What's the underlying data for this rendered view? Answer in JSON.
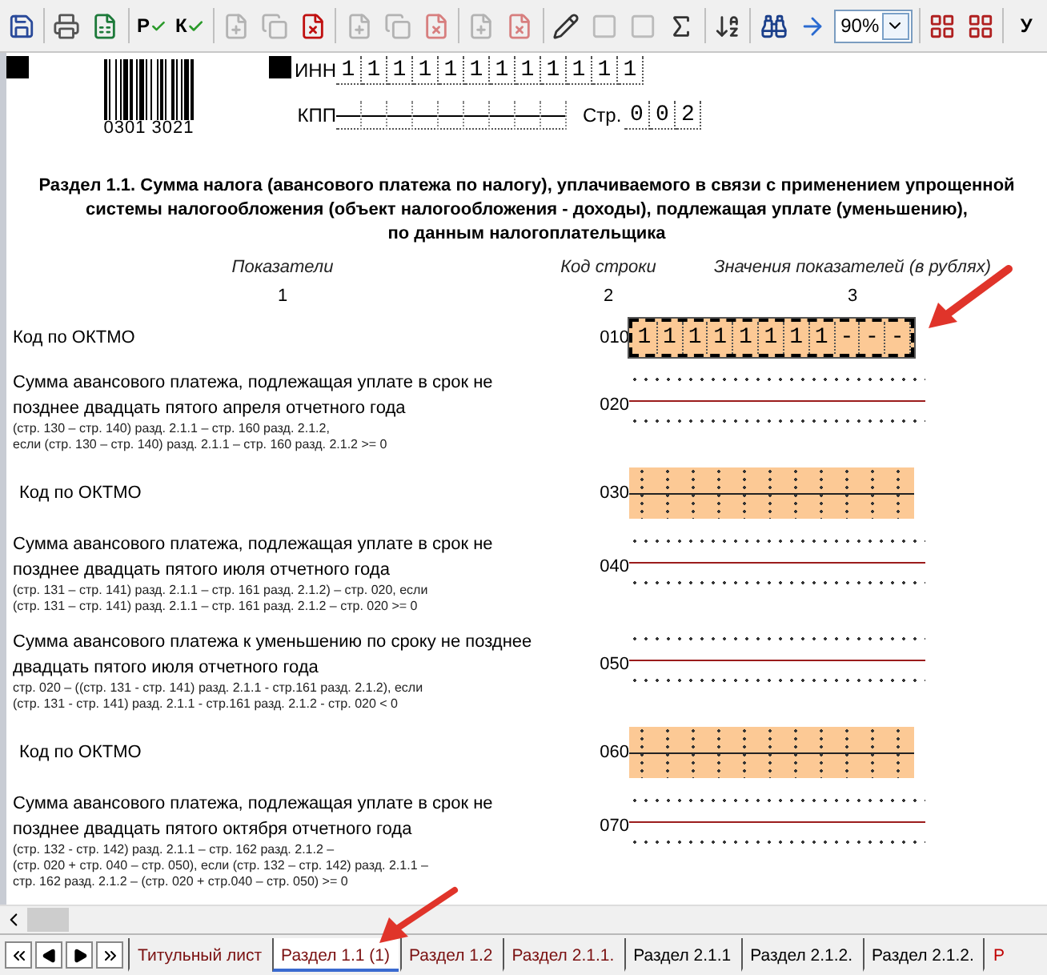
{
  "toolbar": [
    {
      "kind": "save",
      "disabled": false
    },
    {
      "kind": "separator"
    },
    {
      "kind": "print",
      "disabled": false
    },
    {
      "kind": "excel",
      "disabled": false
    },
    {
      "kind": "separator"
    },
    {
      "kind": "check",
      "label": "Р",
      "disabled": false
    },
    {
      "kind": "check",
      "label": "К",
      "disabled": false
    },
    {
      "kind": "separator"
    },
    {
      "kind": "add",
      "disabled": true
    },
    {
      "kind": "copy",
      "disabled": true
    },
    {
      "kind": "delete",
      "disabled": false
    },
    {
      "kind": "separator"
    },
    {
      "kind": "add",
      "disabled": true
    },
    {
      "kind": "copy",
      "disabled": true
    },
    {
      "kind": "delete",
      "disabled": true
    },
    {
      "kind": "separator"
    },
    {
      "kind": "add",
      "disabled": true
    },
    {
      "kind": "delete",
      "disabled": true
    },
    {
      "kind": "separator"
    },
    {
      "kind": "edit",
      "disabled": false
    },
    {
      "kind": "block",
      "disabled": true
    },
    {
      "kind": "block",
      "disabled": true
    },
    {
      "kind": "formula",
      "disabled": false
    },
    {
      "kind": "separator"
    },
    {
      "kind": "sort",
      "disabled": false
    },
    {
      "kind": "separator"
    },
    {
      "kind": "find",
      "disabled": false
    },
    {
      "kind": "goto",
      "disabled": false
    },
    {
      "kind": "zoom",
      "value": "90%"
    },
    {
      "kind": "separator"
    },
    {
      "kind": "view",
      "disabled": false
    },
    {
      "kind": "view",
      "disabled": false
    },
    {
      "kind": "separator"
    },
    {
      "kind": "letter",
      "label": "У",
      "disabled": false
    }
  ],
  "header": {
    "barcode_number": "0301 3021",
    "inn": {
      "label": "ИНН",
      "cells": [
        "1",
        "1",
        "1",
        "1",
        "1",
        "1",
        "1",
        "1",
        "1",
        "1",
        "1",
        "1"
      ]
    },
    "kpp": {
      "label": "КПП"
    },
    "page": {
      "label": "Стр.",
      "cells": [
        "0",
        "0",
        "2"
      ]
    }
  },
  "title": [
    "Раздел 1.1. Сумма налога (авансового платежа по налогу), уплачиваемого в связи с применением упрощенной",
    "системы налогообложения (объект налогообложения - доходы), подлежащая уплате (уменьшению),",
    "по данным налогоплательщика"
  ],
  "columns": [
    {
      "heading": "Показатели",
      "number": "1"
    },
    {
      "heading": "Код строки",
      "number": "2"
    },
    {
      "heading": "Значения показателей (в рублях)",
      "number": "3"
    }
  ],
  "rows": [
    {
      "kind": "oktmo",
      "code": "010",
      "label": "Код по ОКТМО",
      "highlighted": true,
      "focused": true,
      "cells": [
        "1",
        "1",
        "1",
        "1",
        "1",
        "1",
        "1",
        "1",
        "-",
        "-",
        "-"
      ]
    },
    {
      "kind": "amount",
      "code": "020",
      "label": "Сумма авансового платежа, подлежащая уплате в срок не позднее двадцать пятого апреля отчетного года",
      "note": [
        "(стр. 130 – стр. 140) разд. 2.1.1 – стр. 160 разд. 2.1.2,",
        "если (стр. 130 – стр. 140) разд. 2.1.1 – стр. 160 разд. 2.1.2 >= 0"
      ]
    },
    {
      "kind": "oktmo",
      "code": "030",
      "label": "Код по ОКТМО",
      "highlighted": true,
      "focused": false,
      "cells": []
    },
    {
      "kind": "amount",
      "code": "040",
      "label": "Сумма авансового платежа, подлежащая уплате в срок не позднее двадцать пятого июля отчетного года",
      "note": [
        "(стр. 131 – стр. 141) разд. 2.1.1 – стр. 161 разд. 2.1.2) – стр. 020, если",
        "(стр. 131 – стр. 141) разд. 2.1.1 – стр. 161 разд. 2.1.2 – стр. 020 >= 0"
      ]
    },
    {
      "kind": "amount",
      "code": "050",
      "label": "Сумма  авансового платежа к уменьшению по сроку не позднее двадцать пятого июля отчетного года",
      "note": [
        "стр. 020 – ((стр. 131 - стр. 141) разд. 2.1.1 - стр.161 разд. 2.1.2), если",
        "(стр. 131 - стр. 141) разд. 2.1.1 -  стр.161 разд. 2.1.2 - стр. 020 < 0"
      ]
    },
    {
      "kind": "oktmo",
      "code": "060",
      "label": "Код по ОКТМО",
      "highlighted": true,
      "focused": false,
      "cells": []
    },
    {
      "kind": "amount",
      "code": "070",
      "label": "Сумма авансового платежа, подлежащая уплате в срок не позднее двадцать пятого октября отчетного года",
      "note": [
        "(стр. 132 - стр. 142) разд. 2.1.1 – стр. 162 разд. 2.1.2 –",
        "(стр. 020 + стр. 040  – стр. 050), если (стр. 132  –  стр. 142) разд. 2.1.1 –",
        "стр. 162 разд. 2.1.2 – (стр. 020 + стр.040  – стр. 050) >= 0"
      ]
    }
  ],
  "tabs": [
    {
      "label": "Титульный лист",
      "selected": false,
      "color": "#7a1010"
    },
    {
      "label": "Раздел 1.1 (1)",
      "selected": true,
      "color": "#7a1010"
    },
    {
      "label": "Раздел 1.2",
      "selected": false,
      "color": "#7a1010"
    },
    {
      "label": "Раздел 2.1.1.",
      "selected": false,
      "color": "#7a1010"
    },
    {
      "label": "Раздел 2.1.1",
      "selected": false,
      "color": "#000000"
    },
    {
      "label": "Раздел 2.1.2.",
      "selected": false,
      "color": "#000000"
    },
    {
      "label": "Раздел 2.1.2.",
      "selected": false,
      "color": "#000000"
    },
    {
      "label": "Р",
      "selected": false,
      "color": "#c00000"
    }
  ]
}
